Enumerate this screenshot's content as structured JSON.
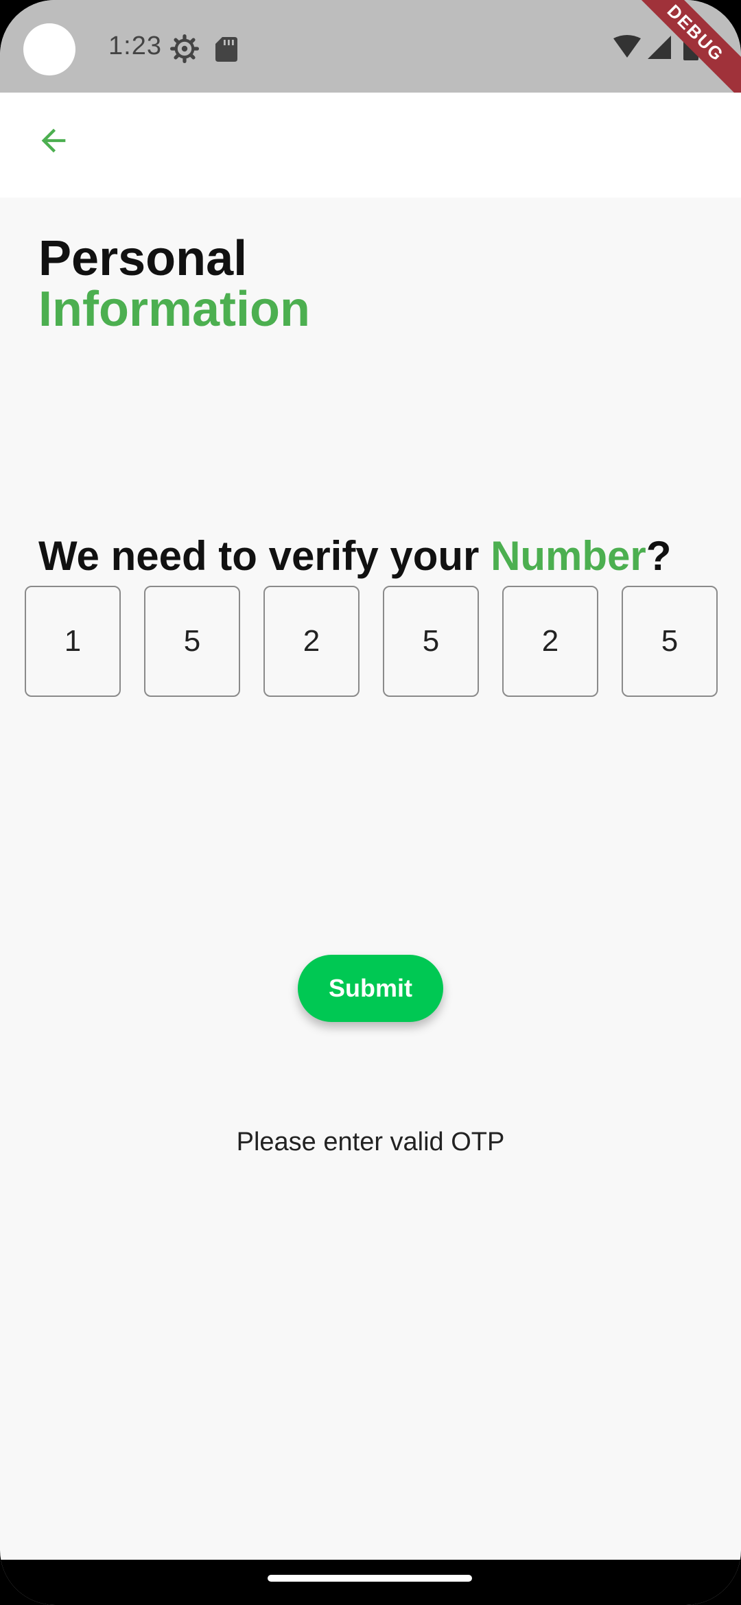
{
  "status_bar": {
    "time": "1:23",
    "icons": [
      "gear-icon",
      "sd-card-icon",
      "wifi-icon",
      "signal-icon",
      "battery-icon"
    ],
    "debug_label": "DEBUG"
  },
  "app_bar": {
    "back_icon": "arrow-left-icon"
  },
  "heading": {
    "line1": "Personal",
    "line2": "Information"
  },
  "verify": {
    "prefix": "We need to verify your ",
    "highlight": "Number",
    "suffix": "?"
  },
  "otp": {
    "digits": [
      "1",
      "5",
      "2",
      "5",
      "2",
      "5"
    ]
  },
  "submit": {
    "label": "Submit"
  },
  "error": {
    "message": "Please enter valid OTP"
  },
  "colors": {
    "accent": "#4caf50",
    "button": "#00c853",
    "status_bar": "#bdbdbd",
    "background": "#f8f8f8"
  }
}
